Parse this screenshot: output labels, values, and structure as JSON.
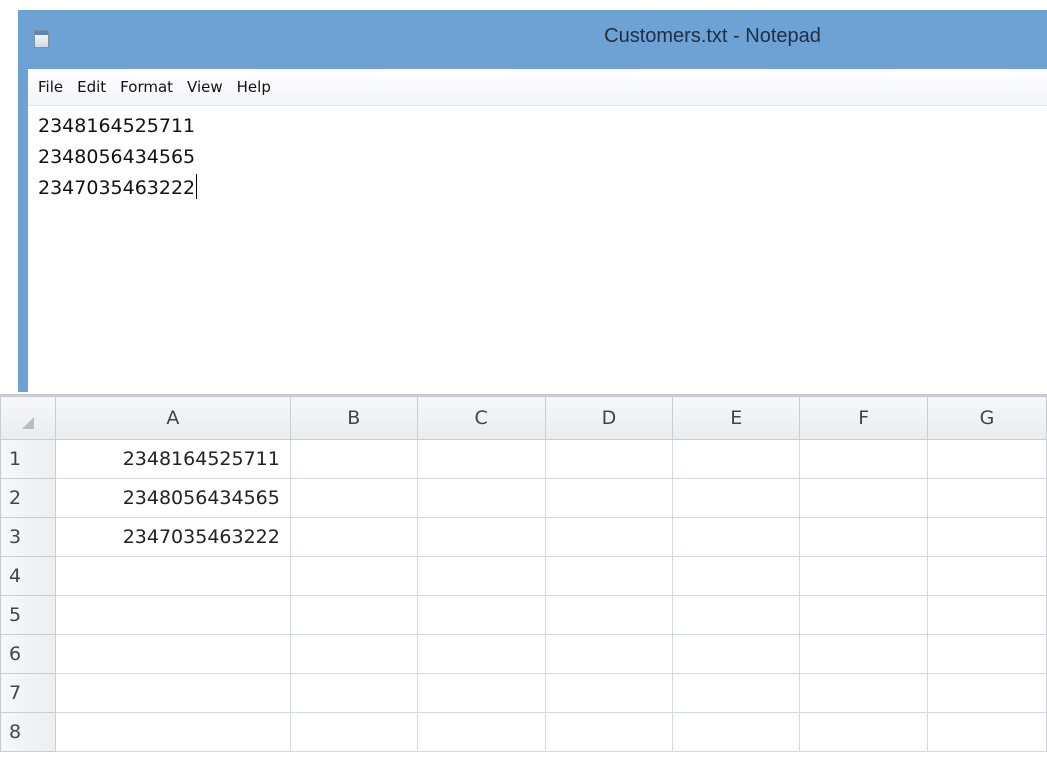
{
  "notepad": {
    "title": "Customers.txt - Notepad",
    "menu": [
      "File",
      "Edit",
      "Format",
      "View",
      "Help"
    ],
    "lines": [
      "2348164525711",
      "2348056434565",
      "2347035463222"
    ]
  },
  "sheet": {
    "columns": [
      "A",
      "B",
      "C",
      "D",
      "E",
      "F",
      "G"
    ],
    "rows": [
      {
        "num": "1",
        "a": "2348164525711"
      },
      {
        "num": "2",
        "a": "2348056434565"
      },
      {
        "num": "3",
        "a": "2347035463222"
      },
      {
        "num": "4",
        "a": ""
      },
      {
        "num": "5",
        "a": ""
      },
      {
        "num": "6",
        "a": ""
      },
      {
        "num": "7",
        "a": ""
      },
      {
        "num": "8",
        "a": ""
      }
    ]
  },
  "colors": {
    "titlebar": "#6fa2d4",
    "grid_line": "#d4d7db",
    "header_bg": "#eceef1"
  }
}
